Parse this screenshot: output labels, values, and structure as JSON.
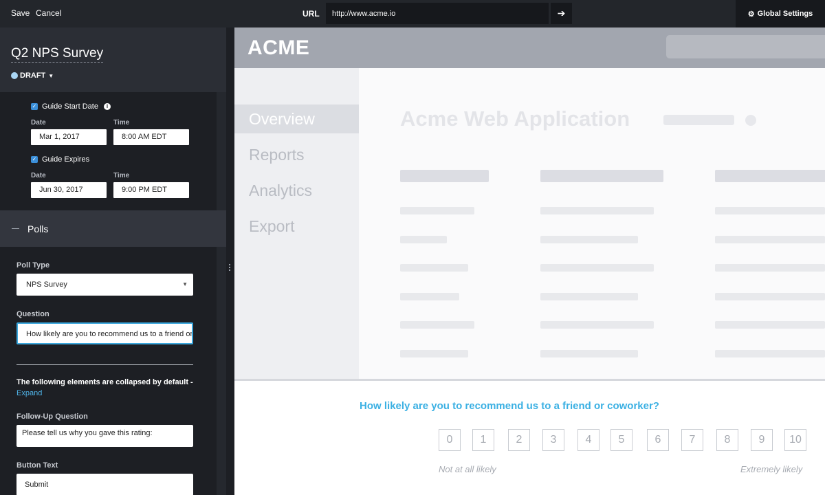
{
  "topbar": {
    "save_label": "Save",
    "cancel_label": "Cancel",
    "url_label": "URL",
    "url_value": "http://www.acme.io",
    "go_icon": "arrow-right-icon",
    "global_settings_label": "Global Settings",
    "global_settings_icon": "gear-icon"
  },
  "guide": {
    "title": "Q2 NPS Survey",
    "status": "DRAFT",
    "status_color": "#a9d6f5"
  },
  "schedule": {
    "start_label": "Guide Start Date",
    "start_checked": true,
    "start_date_label": "Date",
    "start_date": "Mar 1, 2017",
    "start_time_label": "Time",
    "start_time": "8:00 AM EDT",
    "expires_label": "Guide Expires",
    "expires_checked": true,
    "expires_date_label": "Date",
    "expires_date": "Jun 30, 2017",
    "expires_time_label": "Time",
    "expires_time": "9:00 PM EDT"
  },
  "polls": {
    "section_label": "Polls",
    "poll_type_label": "Poll Type",
    "poll_type_value": "NPS Survey",
    "question_label": "Question",
    "question_value": "How likely are you to recommend us to a friend or coworker?",
    "collapsed_note": "The following elements are collapsed by default -",
    "expand_label": "Expand",
    "followup_label": "Follow-Up Question",
    "followup_value": "Please tell us why you gave this rating:",
    "button_text_label": "Button Text",
    "button_text_value": "Submit"
  },
  "preview": {
    "logo": "ACME",
    "nav": [
      "Overview",
      "Reports",
      "Analytics",
      "Export"
    ],
    "active_nav": "Overview",
    "app_title": "Acme Web Application",
    "poll": {
      "question": "How likely are you to recommend us to a friend or coworker?",
      "scale": [
        "0",
        "1",
        "2",
        "3",
        "4",
        "5",
        "6",
        "7",
        "8",
        "9",
        "10"
      ],
      "low_label": "Not at all likely",
      "high_label": "Extremely likely",
      "accent_color": "#3bb0e3"
    }
  }
}
